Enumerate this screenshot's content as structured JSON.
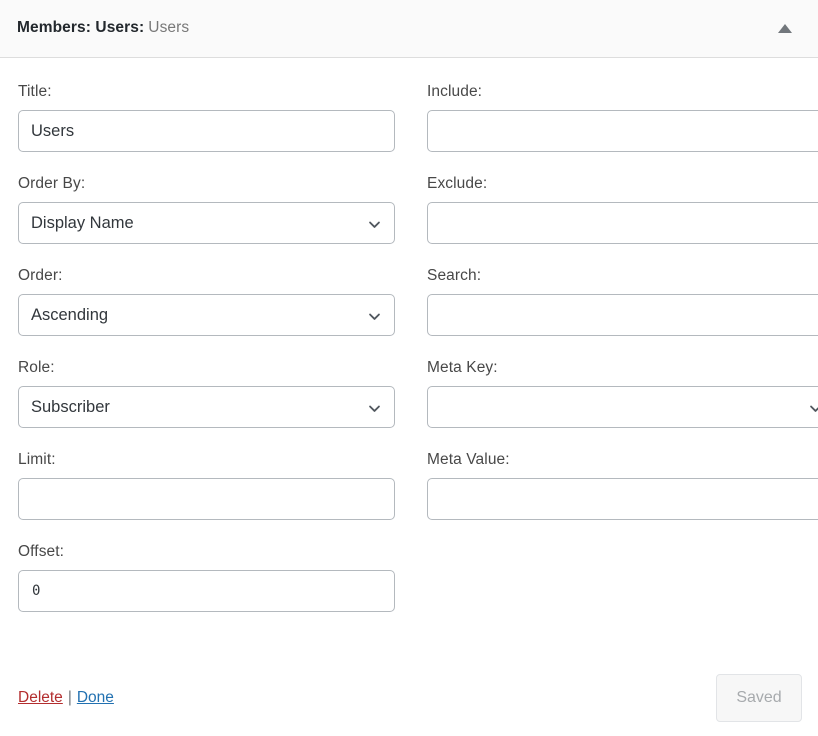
{
  "header": {
    "title_strong": "Members: Users:",
    "title_muted": "Users",
    "collapse_icon": "caret-up-icon"
  },
  "form": {
    "left_column": [
      {
        "label": "Title:",
        "control": "text",
        "value": "Users",
        "placeholder": ""
      },
      {
        "label": "Order By:",
        "control": "select",
        "value": "Display Name",
        "placeholder": ""
      },
      {
        "label": "Order:",
        "control": "select",
        "value": "Ascending",
        "placeholder": ""
      },
      {
        "label": "Role:",
        "control": "select",
        "value": "Subscriber",
        "placeholder": ""
      },
      {
        "label": "Limit:",
        "control": "text",
        "value": "",
        "placeholder": ""
      },
      {
        "label": "Offset:",
        "control": "text",
        "value": "0",
        "placeholder": "",
        "mono": true
      }
    ],
    "right_column": [
      {
        "label": "Include:",
        "control": "text",
        "value": "",
        "placeholder": ""
      },
      {
        "label": "Exclude:",
        "control": "text",
        "value": "",
        "placeholder": ""
      },
      {
        "label": "Search:",
        "control": "text",
        "value": "",
        "placeholder": ""
      },
      {
        "label": "Meta Key:",
        "control": "select",
        "value": "",
        "placeholder": ""
      },
      {
        "label": "Meta Value:",
        "control": "text",
        "value": "",
        "placeholder": ""
      }
    ]
  },
  "footer": {
    "delete_label": "Delete",
    "separator": "|",
    "done_label": "Done",
    "save_button_label": "Saved"
  },
  "colors": {
    "header_bg": "#fafafa",
    "header_border": "#dddddd",
    "title_strong": "#23282d",
    "title_muted": "#787878",
    "label_text": "#484848",
    "input_border": "#b4b9be",
    "delete_link": "#b32d2e",
    "done_link": "#2271b1",
    "saved_button_bg": "#f7f7f7",
    "saved_button_text": "#a7aaad"
  }
}
